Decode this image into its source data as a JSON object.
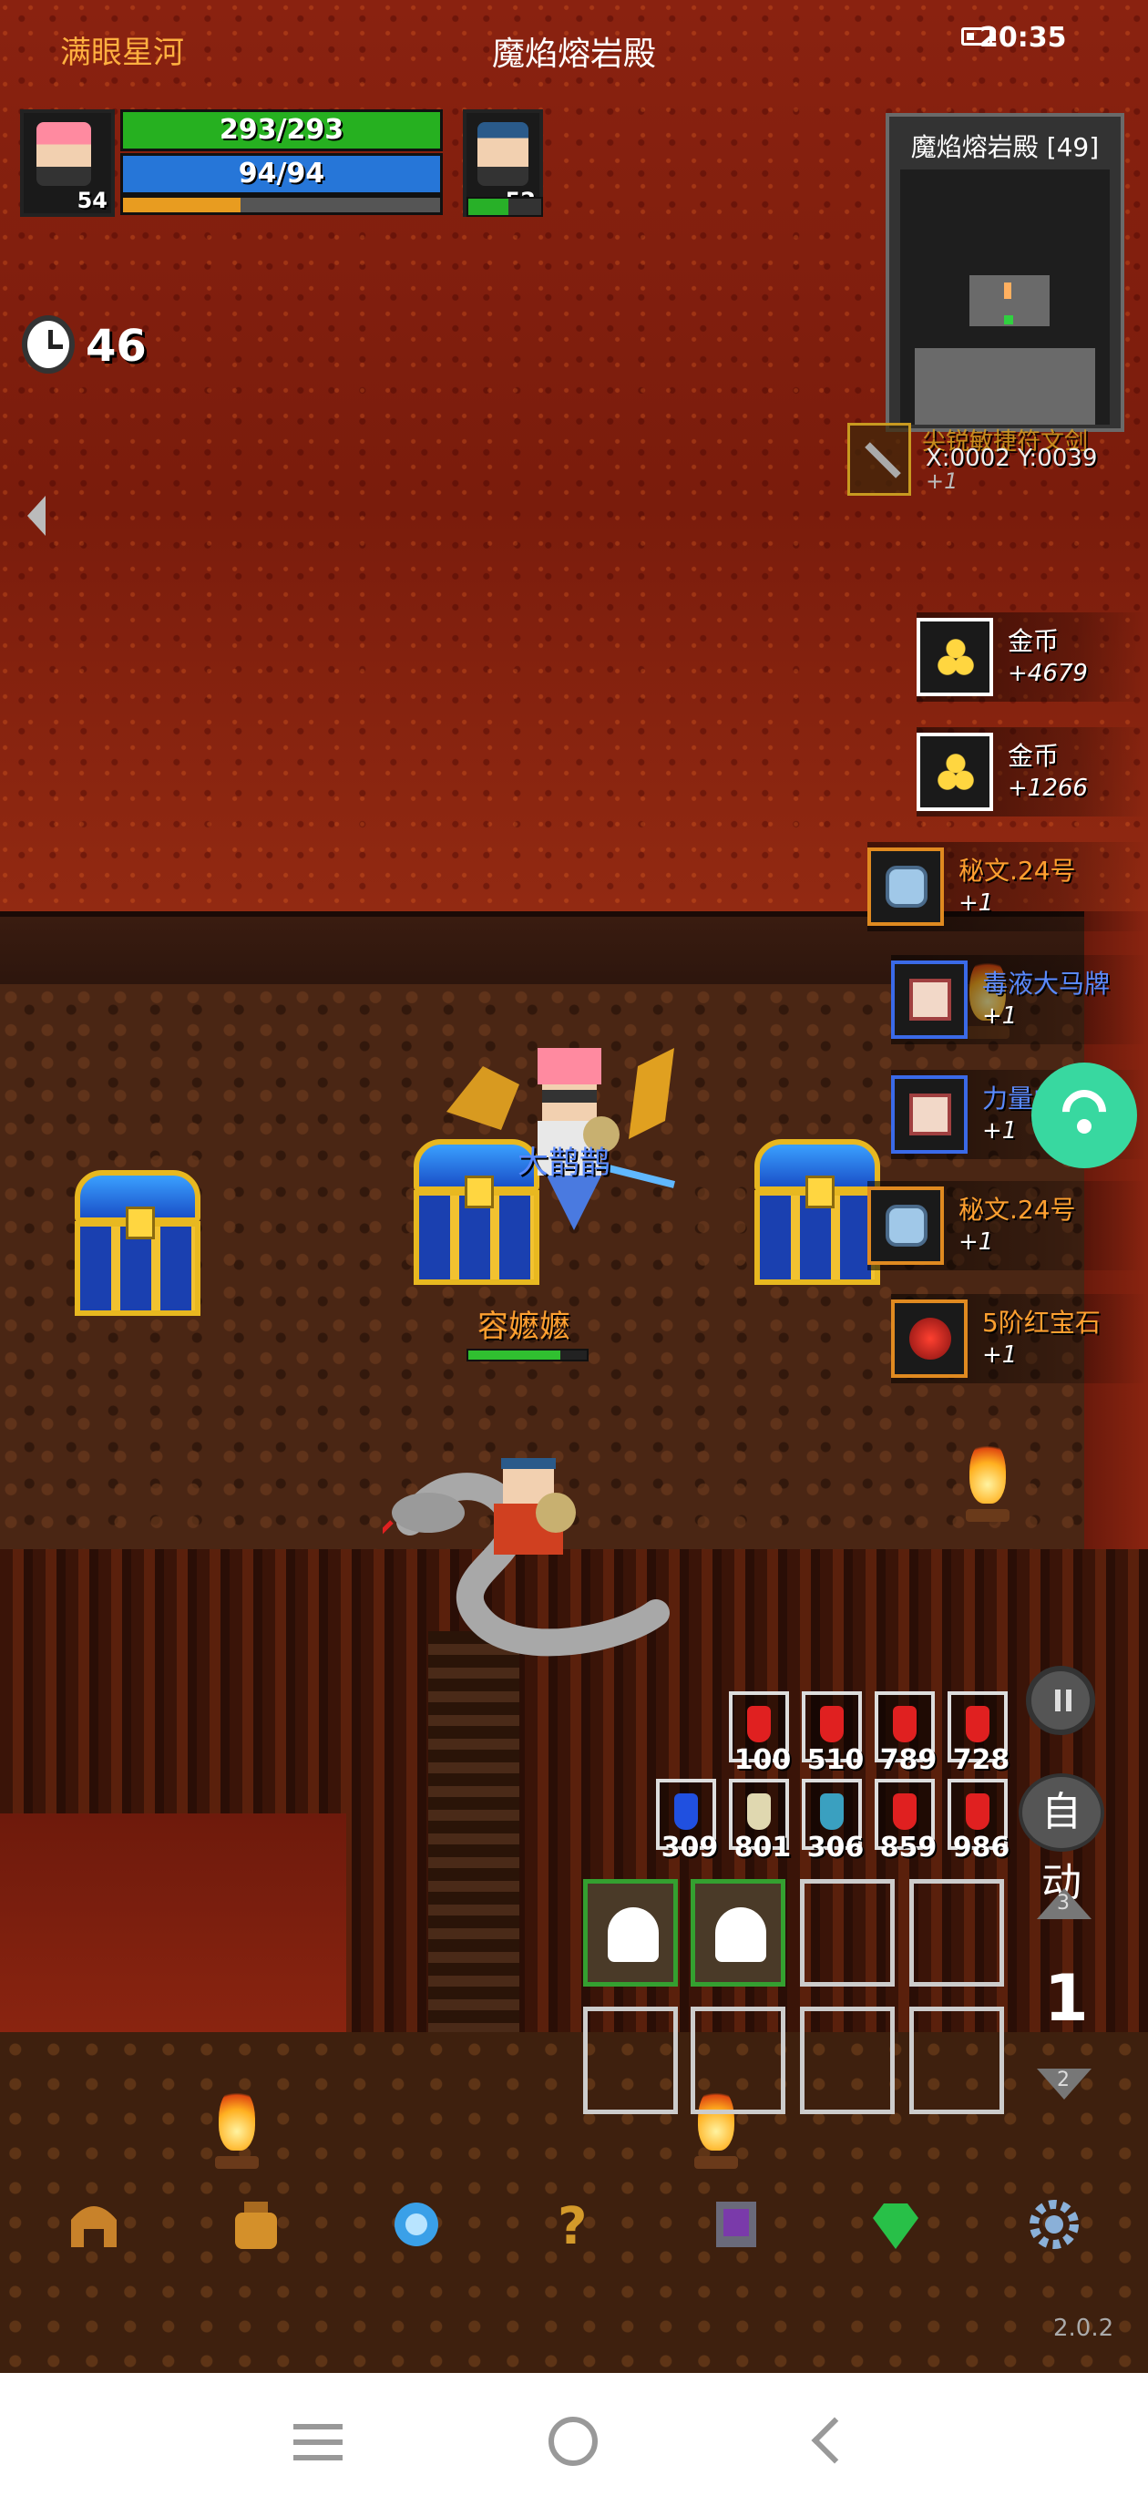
{
  "status_bar": {
    "time": "20:35",
    "battery_icon": "battery-icon"
  },
  "header": {
    "server_name": "满眼星河",
    "map_name": "魔焰熔岩殿"
  },
  "player": {
    "hp": "293/293",
    "mp": "94/94",
    "level": "54",
    "xp_fraction": 0.37
  },
  "pet": {
    "level": "52",
    "hp_fraction": 0.55
  },
  "timer": {
    "value": "46",
    "icon": "clock-icon"
  },
  "minimap": {
    "title": "魔焰熔岩殿 [49]"
  },
  "coords": {
    "text": "X:0002 Y:0039"
  },
  "equip_toast": {
    "item_name": "尖锐敏捷符文剑",
    "count": "+1"
  },
  "loot_feed": [
    {
      "name": "金币",
      "count": "+4679",
      "icon": "gold-coin-icon",
      "color": "white"
    },
    {
      "name": "金币",
      "count": "+1266",
      "icon": "gold-coin-icon",
      "color": "white"
    },
    {
      "name": "秘文.24号",
      "count": "+1",
      "icon": "rune-stone-icon",
      "color": "orange"
    },
    {
      "name": "毒液大马牌",
      "count": "+1",
      "icon": "scroll-icon",
      "color": "blue"
    },
    {
      "name": "力量中",
      "count": "+1",
      "icon": "scroll-icon",
      "color": "blue"
    },
    {
      "name": "秘文.24号",
      "count": "+1",
      "icon": "rune-stone-icon",
      "color": "orange"
    },
    {
      "name": "5阶红宝石",
      "count": "+1",
      "icon": "ruby-icon",
      "color": "orange"
    }
  ],
  "characters": {
    "other_player_name": "大鹊鹊",
    "pet_name": "容嬷嬷"
  },
  "potions": {
    "row1": [
      {
        "count": "100",
        "color": "#e02020"
      },
      {
        "count": "510",
        "color": "#e02020"
      },
      {
        "count": "789",
        "color": "#e02020"
      },
      {
        "count": "728",
        "color": "#e02020"
      }
    ],
    "row2": [
      {
        "count": "309",
        "color": "#2050e0"
      },
      {
        "count": "801",
        "color": "#e0d8b0"
      },
      {
        "count": "306",
        "color": "#3aa0c0"
      },
      {
        "count": "859",
        "color": "#e02020"
      },
      {
        "count": "986",
        "color": "#e02020"
      }
    ]
  },
  "controls": {
    "auto_label": "自动",
    "skill_page": "1",
    "page_up_label": "3",
    "page_down_label": "2"
  },
  "bottom_menu": [
    "helmet-icon",
    "bag-icon",
    "crystal-icon",
    "quest-icon",
    "book-icon",
    "gem-icon",
    "settings-gear-icon"
  ],
  "version": "2.0.2",
  "colors": {
    "hp": "#26b020",
    "mp": "#2676d8",
    "xp": "#e89c20",
    "wifi": "#38d8a0"
  }
}
